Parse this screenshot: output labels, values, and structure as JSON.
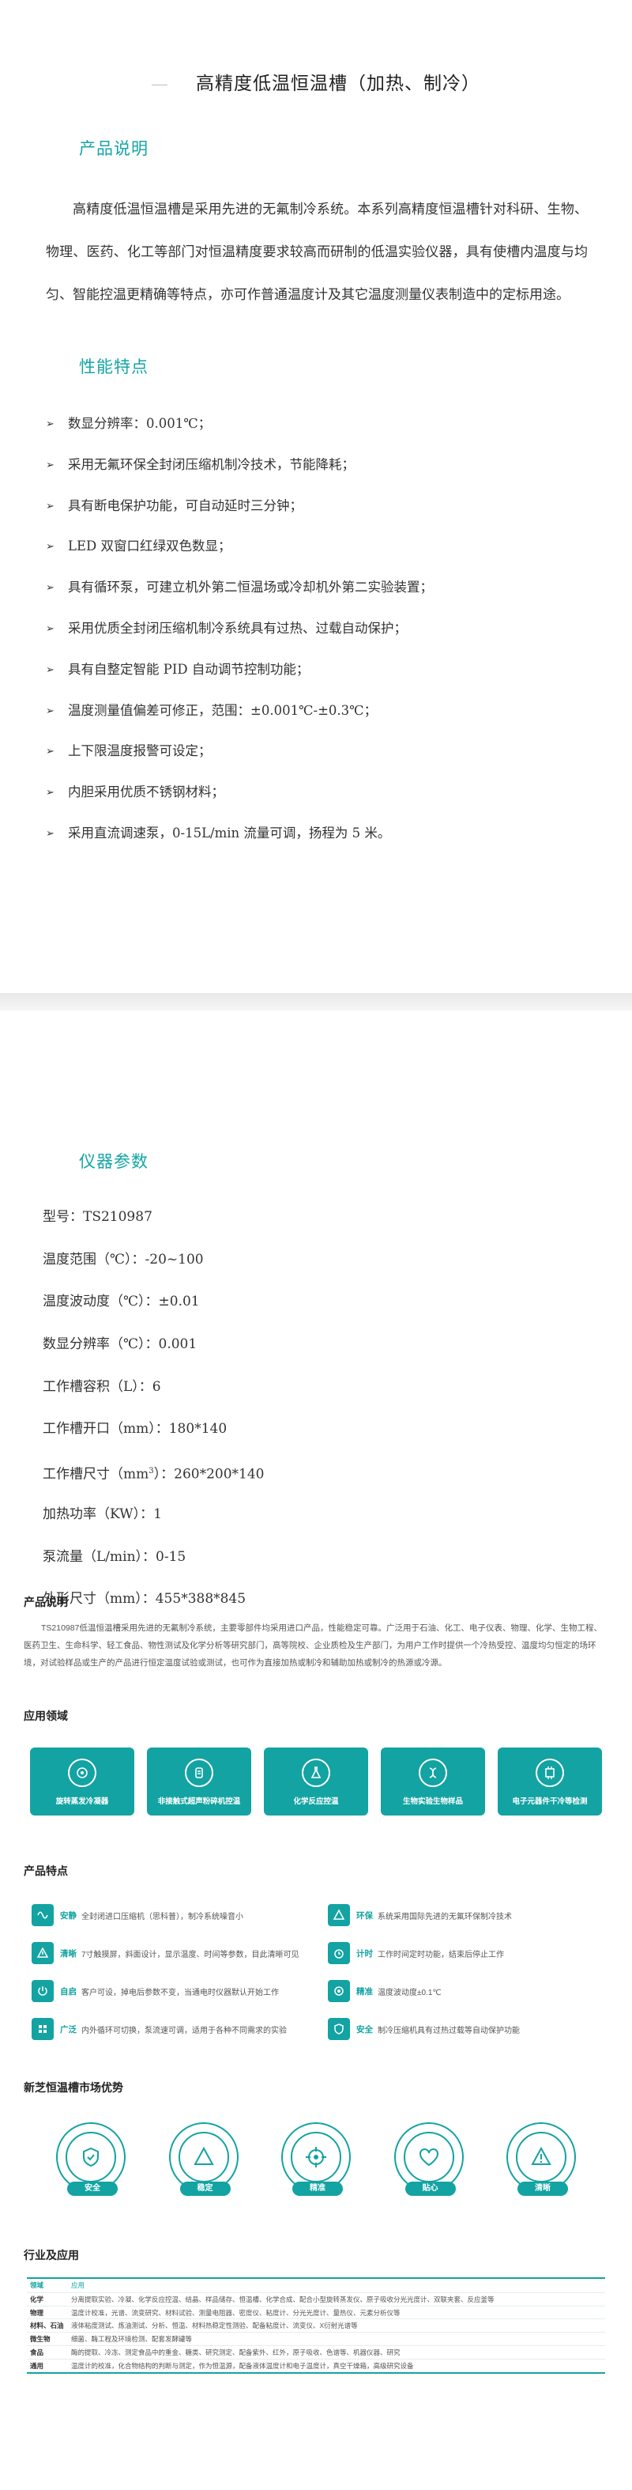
{
  "title": "高精度低温恒温槽（加热、制冷）",
  "section1": {
    "heading": "产品说明",
    "intro": "高精度低温恒温槽是采用先进的无氟制冷系统。本系列高精度恒温槽针对科研、生物、物理、医药、化工等部门对恒温精度要求较高而研制的低温实验仪器，具有使槽内温度与均匀、智能控温更精确等特点，亦可作普通温度计及其它温度测量仪表制造中的定标用途。"
  },
  "section2": {
    "heading": "性能特点",
    "bullet": "➢",
    "items": [
      "数显分辨率：0.001℃；",
      "采用无氟环保全封闭压缩机制冷技术，节能降耗；",
      "具有断电保护功能，可自动延时三分钟；",
      "LED 双窗口红绿双色数显；",
      "具有循环泵，可建立机外第二恒温场或冷却机外第二实验装置；",
      "采用优质全封闭压缩机制冷系统具有过热、过载自动保护；",
      "具有自整定智能 PID 自动调节控制功能；",
      "温度测量值偏差可修正，范围：±0.001℃-±0.3℃；",
      "上下限温度报警可设定；",
      "内胆采用优质不锈钢材料；",
      "采用直流调速泵，0-15L/min 流量可调，扬程为 5 米。"
    ]
  },
  "section3": {
    "heading": "仪器参数",
    "params": [
      "型号：TS210987",
      "温度范围（℃）：-20~100",
      "温度波动度（℃）：±0.01",
      "数显分辨率（℃）：0.001",
      "工作槽容积（L）：6",
      "工作槽开口（mm）：180*140",
      "工作槽尺寸（mm",
      "加热功率（KW）：1",
      "泵流量（L/min）：0-15",
      "外形尺寸（mm）：455*388*845"
    ],
    "size_sup": "3",
    "size_rest": "）：260*200*140"
  },
  "sheet": {
    "desc_title": "产品说明",
    "desc": "TS210987低温恒温槽采用先进的无氟制冷系统，主要零部件均采用进口产品，性能稳定可靠。广泛用于石油、化工、电子仪表、物理、化学、生物工程、医药卫生、生命科学、轻工食品、物性测试及化学分析等研究部门，高等院校、企业质检及生产部门，为用户工作时提供一个冷热受控、温度均匀恒定的场环境，对试验样品或生产的产品进行恒定温度试验或测试，也可作为直接加热或制冷和辅助加热或制冷的热源或冷源。",
    "app_title": "应用领域",
    "apps": [
      {
        "label": "旋转蒸发冷凝器",
        "icon": "rotary-evaporator-icon"
      },
      {
        "label": "非接触式超声粉碎机控温",
        "icon": "ultrasonic-icon"
      },
      {
        "label": "化学反应控温",
        "icon": "flask-icon"
      },
      {
        "label": "生物实验生物样品",
        "icon": "biology-icon"
      },
      {
        "label": "电子元器件干冷等检测",
        "icon": "electronic-icon"
      }
    ],
    "feat_title": "产品特点",
    "features": [
      {
        "key": "安静",
        "text": "全封闭进口压缩机（思科普），制冷系统噪音小",
        "icon": "wave-icon"
      },
      {
        "key": "环保",
        "text": "系统采用国际先进的无氟环保制冷技术",
        "icon": "triangle-icon"
      },
      {
        "key": "清晰",
        "text": "7寸触摸屏，斜面设计，显示温度、时间等参数，目此清晰可见",
        "icon": "warning-icon"
      },
      {
        "key": "计时",
        "text": "工作时间定时功能，结束后停止工作",
        "icon": "timer-icon"
      },
      {
        "key": "自启",
        "text": "客户可设，掉电后参数不变，当通电时仪器默认开始工作",
        "icon": "power-icon"
      },
      {
        "key": "精准",
        "text": "温度波动度±0.1℃",
        "icon": "target-icon"
      },
      {
        "key": "广泛",
        "text": "内外循环可切换，泵流速可调，适用于各种不同需求的实验",
        "icon": "grid-icon"
      },
      {
        "key": "安全",
        "text": "制冷压缩机具有过热过载等自动保护功能",
        "icon": "shield-icon"
      }
    ],
    "adv_title": "新芝恒温槽市场优势",
    "advantages": [
      {
        "label": "安全",
        "icon": "safety-icon"
      },
      {
        "label": "稳定",
        "icon": "stability-icon"
      },
      {
        "label": "精准",
        "icon": "precision-icon"
      },
      {
        "label": "贴心",
        "icon": "heart-icon"
      },
      {
        "label": "清晰",
        "icon": "clear-icon"
      }
    ],
    "table_title": "行业及应用",
    "table_head": [
      "领域",
      "应用"
    ],
    "table_rows": [
      [
        "化学",
        "分离提取实验、冷凝、化学反应控温、结晶、样品储存、恒温槽、化学合成、配合小型旋转蒸发仪、原子吸收分光光度计、双联夹套、反应釜等"
      ],
      [
        "物理",
        "温度计校准，光谱、流变研究、材料试验、测量电阻器、密度仪、粘度计、分光光度计、量热仪、元素分析仪等"
      ],
      [
        "材料、石油",
        "液体粘度测试、炼油测试、分析、恒温、材料热稳定性测验、配备粘度计、流变仪、X衍射光谱等"
      ],
      [
        "微生物",
        "细菌、酶工程及环境检测、配套发酵罐等"
      ],
      [
        "食品",
        "酶的提取、冷冻、测定食品中的重金、糖类、研究测定、配备紫外、红外，原子吸收、色谱等、机器仪器、研究"
      ],
      [
        "通用",
        "温度计的校准，化合物结构的判断与测定，作为恒温源，配备液体温度计和电子温度计，真空干燥箱，高级研究设备"
      ]
    ]
  }
}
